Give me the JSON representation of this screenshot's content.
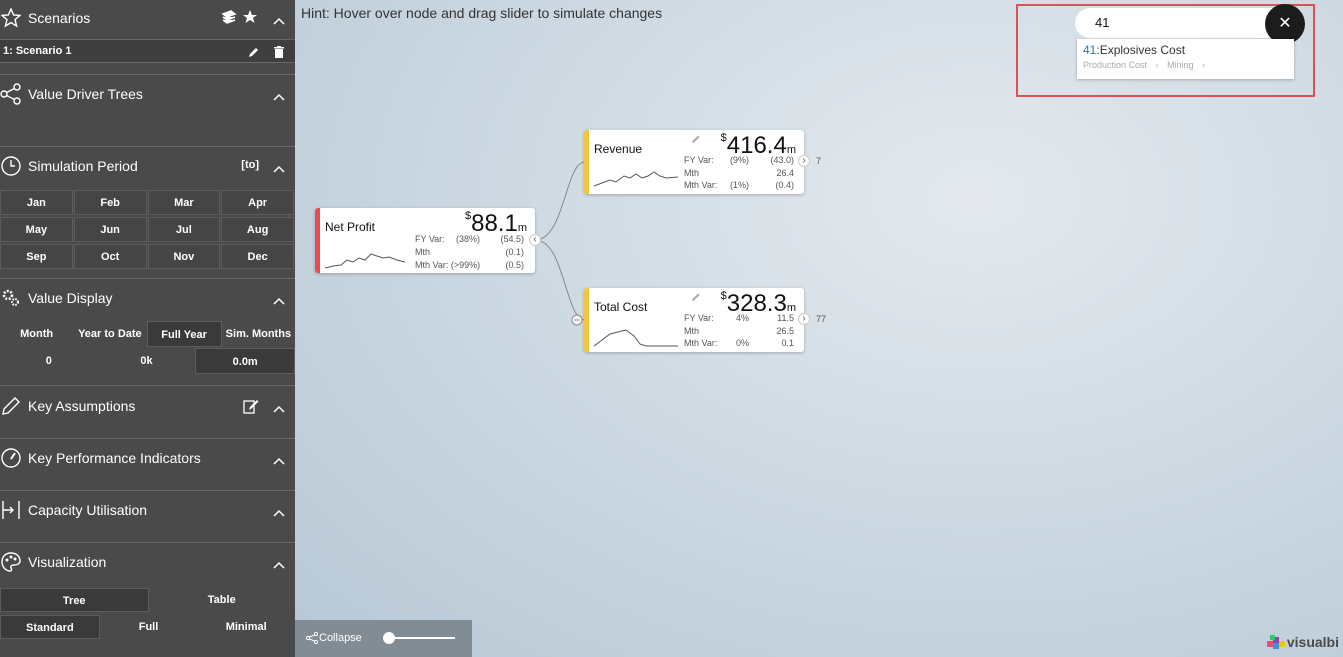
{
  "sidebar": {
    "scenarios": {
      "title": "Scenarios",
      "item": "1: Scenario 1"
    },
    "value_driver_trees": {
      "title": "Value Driver Trees"
    },
    "simulation_period": {
      "title": "Simulation Period",
      "badge": "[to]",
      "months": [
        "Jan",
        "Feb",
        "Mar",
        "Apr",
        "May",
        "Jun",
        "Jul",
        "Aug",
        "Sep",
        "Oct",
        "Nov",
        "Dec"
      ]
    },
    "value_display": {
      "title": "Value Display",
      "options": [
        "Month",
        "Year to Date",
        "Full Year",
        "Sim. Months"
      ],
      "values": [
        "0",
        "0k",
        "0.0m"
      ]
    },
    "key_assumptions": {
      "title": "Key Assumptions"
    },
    "kpis": {
      "title": "Key Performance Indicators"
    },
    "capacity": {
      "title": "Capacity Utilisation"
    },
    "visualization": {
      "title": "Visualization",
      "row1": [
        "Tree",
        "Table"
      ],
      "row2": [
        "Standard",
        "Full",
        "Minimal"
      ]
    }
  },
  "canvas": {
    "hint": "Hint: Hover over node and drag slider to simulate changes",
    "nodes": {
      "net_profit": {
        "title": "Net Profit",
        "currency": "$",
        "value": "88.1",
        "unit": "m",
        "fy_var_label": "FY Var:",
        "fy_var_pct": "(38%)",
        "fy_var_val": "(54.5)",
        "mth_label": "Mth",
        "mth_val": "(0.1)",
        "mth_var_label": "Mth Var: (>99%)",
        "mth_var_val": "(0.5)",
        "color": "#e84c4c"
      },
      "revenue": {
        "title": "Revenue",
        "currency": "$",
        "value": "416.4",
        "unit": "m",
        "fy_var_label": "FY Var:",
        "fy_var_pct": "(9%)",
        "fy_var_val": "(43.0)",
        "mth_label": "Mth",
        "mth_val": "26.4",
        "mth_var_label": "Mth Var:",
        "mth_var_pct": "(1%)",
        "mth_var_val": "(0.4)",
        "child_count": "7",
        "color": "#f2c53d"
      },
      "total_cost": {
        "title": "Total Cost",
        "currency": "$",
        "value": "328.3",
        "unit": "m",
        "fy_var_label": "FY Var:",
        "fy_var_pct": "4%",
        "fy_var_val": "11.5",
        "mth_label": "Mth",
        "mth_val": "26.5",
        "mth_var_label": "Mth Var:",
        "mth_var_pct": "0%",
        "mth_var_val": "0.1",
        "child_count": "77",
        "color": "#f2c53d"
      }
    },
    "search": {
      "query": "41",
      "result_id": "41",
      "result_name": ":Explosives Cost",
      "breadcrumb": [
        "Production Cost",
        "Mining"
      ]
    },
    "collapse_label": "Collapse",
    "logo_text": "visualbi"
  }
}
